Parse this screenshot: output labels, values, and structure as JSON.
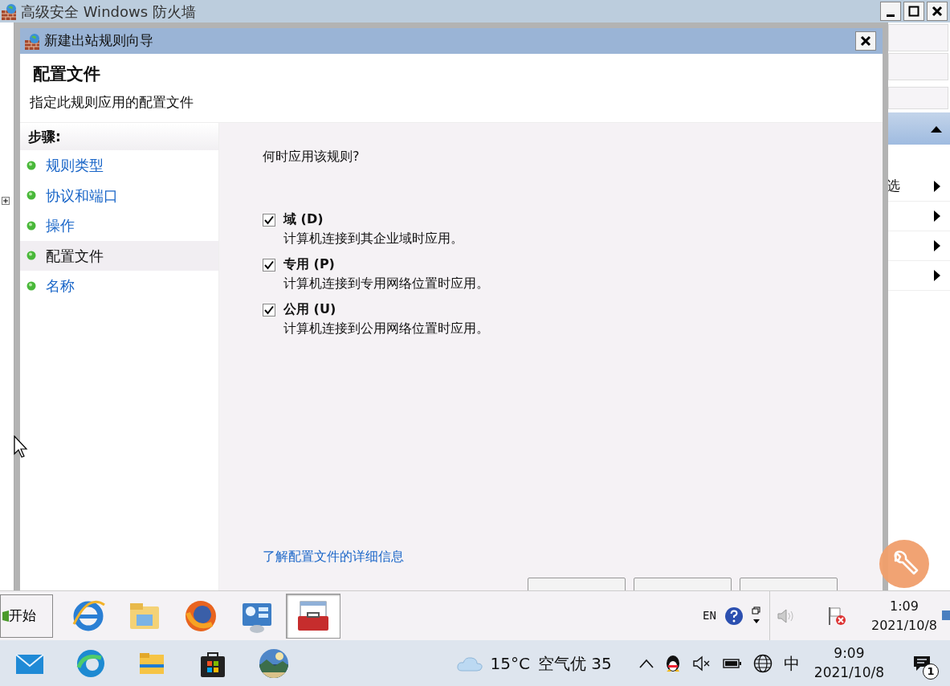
{
  "main_window": {
    "title": "高级安全 Windows 防火墙",
    "action_pane": [
      {
        "label": "选",
        "submenu": true
      },
      {
        "submenu": true
      },
      {
        "submenu": true
      },
      {
        "submenu": true
      }
    ]
  },
  "wizard": {
    "title": "新建出站规则向导",
    "heading": "配置文件",
    "subheading": "指定此规则应用的配置文件",
    "steps_title": "步骤:",
    "steps": [
      {
        "label": "规则类型",
        "selected": false
      },
      {
        "label": "协议和端口",
        "selected": false
      },
      {
        "label": "操作",
        "selected": false
      },
      {
        "label": "配置文件",
        "selected": true
      },
      {
        "label": "名称",
        "selected": false
      }
    ],
    "question": "何时应用该规则?",
    "options": [
      {
        "label": "域 (D)",
        "description": "计算机连接到其企业域时应用。",
        "checked": true
      },
      {
        "label": "专用 (P)",
        "description": "计算机连接到专用网络位置时应用。",
        "checked": true
      },
      {
        "label": "公用 (U)",
        "description": "计算机连接到公用网络位置时应用。",
        "checked": true
      }
    ],
    "link": "了解配置文件的详细信息"
  },
  "legacy_taskbar": {
    "start_label": "开始",
    "apps": [
      {
        "selected": false
      },
      {
        "selected": false
      },
      {
        "selected": false
      },
      {
        "selected": false
      },
      {
        "selected": true
      }
    ],
    "language": "EN",
    "time": "1:09",
    "date": "2021/10/8"
  },
  "taskbar": {
    "temperature": "15°C",
    "air_quality": "空气优 35",
    "ime": "中",
    "time": "9:09",
    "date": "2021/10/8",
    "notification_count": "1"
  }
}
